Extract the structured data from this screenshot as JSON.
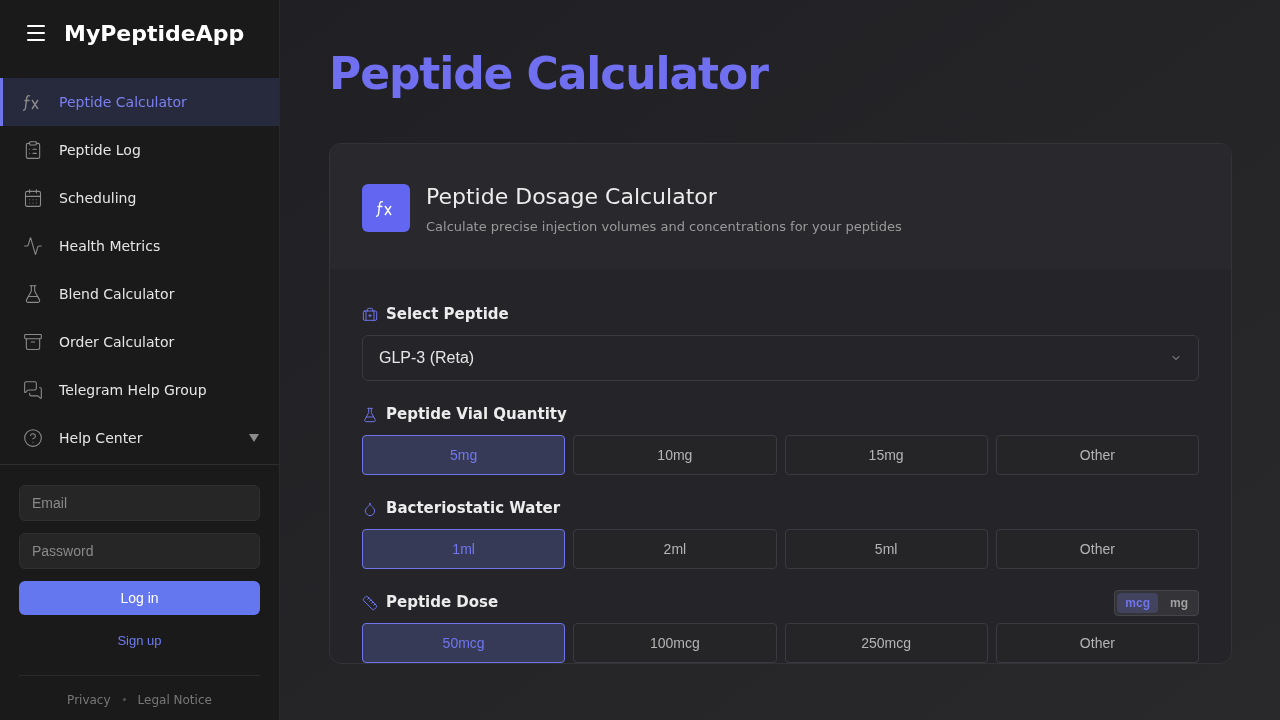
{
  "app": {
    "title": "MyPeptideApp"
  },
  "sidebar": {
    "items": [
      {
        "label": "Peptide Calculator",
        "selected": true,
        "expandable": false
      },
      {
        "label": "Peptide Log",
        "selected": false,
        "expandable": false
      },
      {
        "label": "Scheduling",
        "selected": false,
        "expandable": false
      },
      {
        "label": "Health Metrics",
        "selected": false,
        "expandable": false
      },
      {
        "label": "Blend Calculator",
        "selected": false,
        "expandable": false
      },
      {
        "label": "Order Calculator",
        "selected": false,
        "expandable": false
      },
      {
        "label": "Telegram Help Group",
        "selected": false,
        "expandable": false
      },
      {
        "label": "Help Center",
        "selected": false,
        "expandable": true
      }
    ],
    "login": {
      "email_placeholder": "Email",
      "password_placeholder": "Password",
      "login_button": "Log in",
      "signup_link": "Sign up"
    },
    "footer_links": [
      "Privacy",
      "Legal Notice"
    ]
  },
  "page": {
    "title": "Peptide Calculator"
  },
  "card": {
    "title": "Peptide Dosage Calculator",
    "subtitle": "Calculate precise injection volumes and concentrations for your peptides",
    "sections": [
      {
        "kind": "select",
        "label": "Select Peptide",
        "value": "GLP-3 (Reta)"
      },
      {
        "kind": "options",
        "label": "Peptide Vial Quantity",
        "options": [
          {
            "label": "5mg",
            "selected": true
          },
          {
            "label": "10mg",
            "selected": false
          },
          {
            "label": "15mg",
            "selected": false
          },
          {
            "label": "Other",
            "selected": false
          }
        ]
      },
      {
        "kind": "options",
        "label": "Bacteriostatic Water",
        "options": [
          {
            "label": "1ml",
            "selected": true
          },
          {
            "label": "2ml",
            "selected": false
          },
          {
            "label": "5ml",
            "selected": false
          },
          {
            "label": "Other",
            "selected": false
          }
        ]
      },
      {
        "kind": "options",
        "label": "Peptide Dose",
        "units": [
          {
            "label": "mcg",
            "selected": true
          },
          {
            "label": "mg",
            "selected": false
          }
        ],
        "options": [
          {
            "label": "50mcg",
            "selected": true
          },
          {
            "label": "100mcg",
            "selected": false
          },
          {
            "label": "250mcg",
            "selected": false
          },
          {
            "label": "Other",
            "selected": false
          }
        ]
      }
    ]
  }
}
